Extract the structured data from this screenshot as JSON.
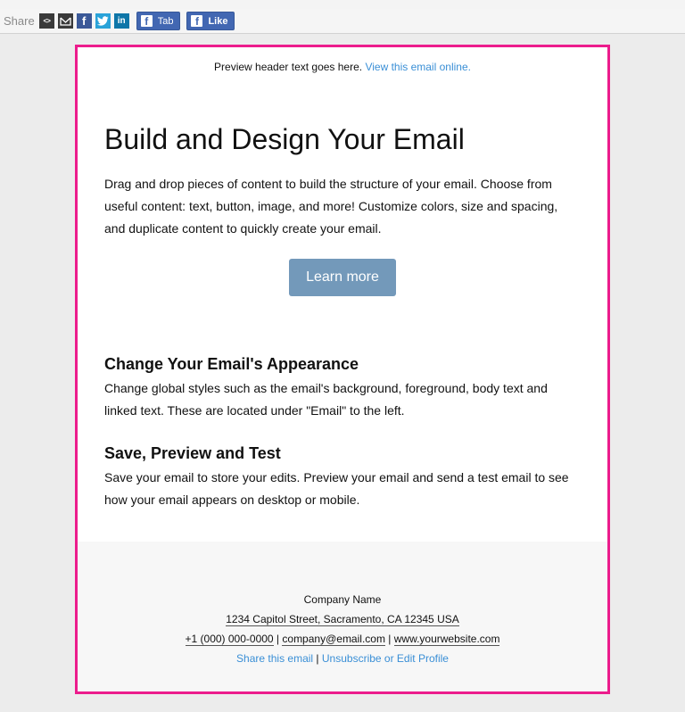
{
  "share_bar": {
    "label": "Share",
    "icons": [
      {
        "name": "embed",
        "glyph": "<>"
      },
      {
        "name": "email",
        "glyph": "✉"
      },
      {
        "name": "facebook",
        "glyph": "f"
      },
      {
        "name": "twitter",
        "glyph": "t"
      },
      {
        "name": "linkedin",
        "glyph": "in"
      }
    ],
    "tab_button": "Tab",
    "like_button": "Like"
  },
  "preview": {
    "text": "Preview header text goes here. ",
    "link": "View this email online."
  },
  "main": {
    "heading": "Build and Design Your Email",
    "intro": "Drag and drop pieces of content to build the structure of your email. Choose from useful content: text, button, image, and more! Customize colors, size and spacing, and duplicate content to quickly create your email.",
    "button": "Learn more"
  },
  "sections": [
    {
      "title": "Change Your Email's Appearance",
      "body": "Change global styles such as the email's background, foreground, body text and linked text. These are located under \"Email\" to the left."
    },
    {
      "title": "Save, Preview and Test",
      "body": "Save your email to store your edits. Preview your email and send a test email to see how your email appears on desktop or mobile."
    }
  ],
  "footer": {
    "company": "Company Name",
    "address": "1234 Capitol Street, Sacramento, CA 12345 USA",
    "phone": "+1 (000) 000-0000",
    "sep": " | ",
    "email": "company@email.com",
    "website": "www.yourwebsite.com",
    "share_link": "Share this email",
    "unsubscribe_link": "Unsubscribe or Edit Profile"
  },
  "colors": {
    "frame_border": "#ec1c8c",
    "button_bg": "#7399ba",
    "link": "#3a8fd6"
  }
}
